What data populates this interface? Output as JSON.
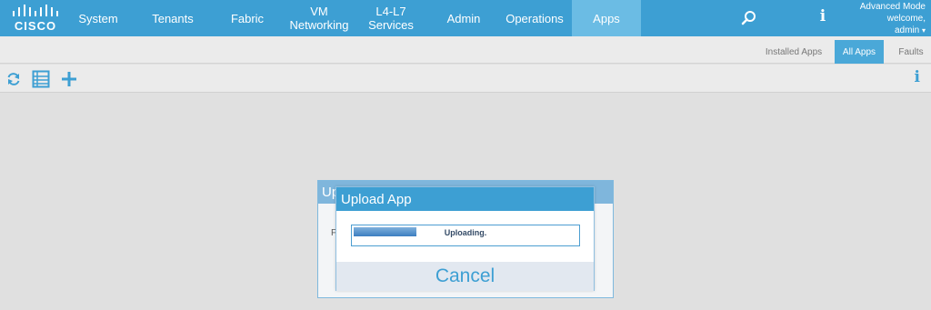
{
  "brand": {
    "logo_text": "CISCO"
  },
  "nav": {
    "items": [
      {
        "label": "System"
      },
      {
        "label": "Tenants"
      },
      {
        "label": "Fabric"
      },
      {
        "label": "VM\nNetworking"
      },
      {
        "label": "L4-L7\nServices"
      },
      {
        "label": "Admin"
      },
      {
        "label": "Operations"
      },
      {
        "label": "Apps",
        "active": true
      }
    ],
    "search_icon": "search-icon",
    "info_icon": "info-icon",
    "info_glyph": "i"
  },
  "user": {
    "mode": "Advanced Mode",
    "welcome": "welcome,",
    "name": "admin",
    "caret": "▾"
  },
  "subtabs": [
    {
      "label": "Installed Apps"
    },
    {
      "label": "All Apps",
      "active": true
    },
    {
      "label": "Faults"
    }
  ],
  "toolbar": {
    "icons": [
      "refresh-icon",
      "list-icon",
      "add-icon"
    ],
    "info_glyph": "i"
  },
  "bg_dialog": {
    "title": "Upload App",
    "field_initial": "F"
  },
  "dialog": {
    "title": "Upload App",
    "progress_text": "Uploading.",
    "progress_fraction": 0.28,
    "cancel_label": "Cancel"
  },
  "colors": {
    "accent": "#3d9fd3",
    "active_tab": "#6bbce4",
    "progress": "#3c7fc0"
  }
}
